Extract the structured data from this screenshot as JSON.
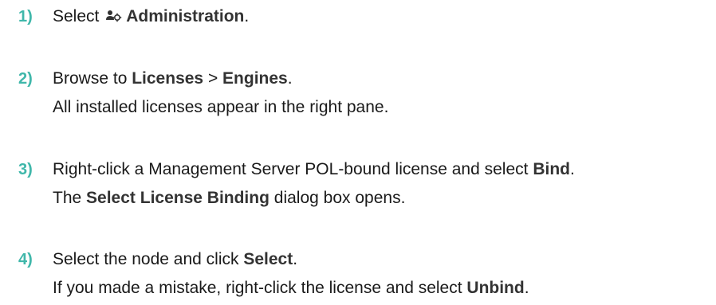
{
  "steps": [
    {
      "number": "1)",
      "line1": {
        "before": "Select ",
        "icon": "administration-icon",
        "bold": "Administration",
        "after": "."
      }
    },
    {
      "number": "2)",
      "line1": {
        "before": "Browse to ",
        "bold1": "Licenses",
        "sep": " > ",
        "bold2": "Engines",
        "after": "."
      },
      "line2": "All installed licenses appear in the right pane."
    },
    {
      "number": "3)",
      "line1": {
        "before": "Right-click a Management Server POL-bound license and select ",
        "bold": "Bind",
        "after": "."
      },
      "line2": {
        "before": "The ",
        "bold": "Select License Binding",
        "after": " dialog box opens."
      }
    },
    {
      "number": "4)",
      "line1": {
        "before": "Select the node and click ",
        "bold": "Select",
        "after": "."
      },
      "line2": {
        "before": "If you made a mistake, right-click the license and select ",
        "bold": "Unbind",
        "after": "."
      }
    }
  ],
  "colors": {
    "step_number": "#3fb7aa",
    "text": "#1a1a1a"
  }
}
